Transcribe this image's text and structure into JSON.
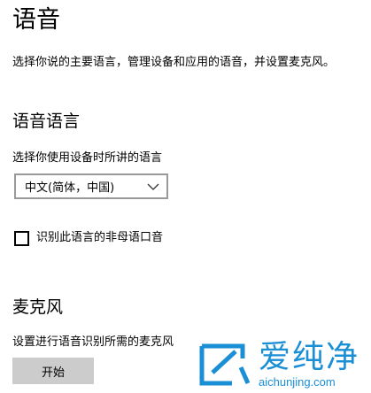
{
  "page": {
    "title": "语音",
    "intro": "选择你说的主要语言，管理设备和应用的语音，并设置麦克风。"
  },
  "speech_language": {
    "heading": "语音语言",
    "select_label": "选择你使用设备时所讲的语言",
    "selected_language": "中文(简体，中国)",
    "non_native_checkbox_label": "识别此语言的非母语口音",
    "non_native_checked": false
  },
  "microphone": {
    "heading": "麦克风",
    "description": "设置进行语音识别所需的麦克风",
    "start_button": "开始"
  },
  "watermark": {
    "brand": "爱纯净",
    "url": "aichunjing.com",
    "color": "#1b8fd6"
  }
}
